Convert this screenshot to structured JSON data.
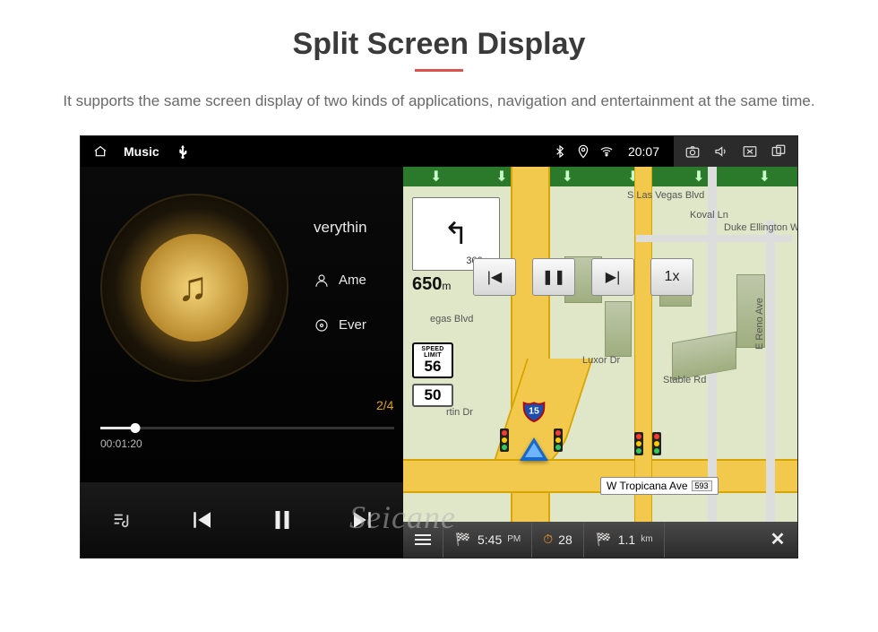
{
  "page": {
    "title": "Split Screen Display",
    "subtitle": "It supports the same screen display of two kinds of applications, navigation and entertainment at the same time."
  },
  "statusbar": {
    "app_label": "Music",
    "time": "20:07"
  },
  "music": {
    "track_title": "verythin",
    "artist": "Ame",
    "album": "Ever",
    "counter": "2/4",
    "elapsed": "00:01:20"
  },
  "nav": {
    "street_top": "S Las Vegas Blvd",
    "labels": {
      "koval": "Koval Ln",
      "duke": "Duke Ellington Way",
      "egas": "egas Blvd",
      "luxor": "Luxor Dr",
      "stable": "Stable Rd",
      "reno": "E Reno Ave",
      "rtindr": "rtin Dr"
    },
    "tropicana_label": "W Tropicana Ave",
    "tropicana_badge": "593",
    "turn": {
      "dist_small": "300 m",
      "dist_big": "650",
      "dist_big_unit": "m"
    },
    "speed": {
      "limit_label": "SPEED LIMIT",
      "limit": "56",
      "current": "50"
    },
    "interstate": "15",
    "map_play_speed": "1x",
    "bottom": {
      "eta": "5:45",
      "eta_ampm": "PM",
      "fuel": "28",
      "dist": "1.1",
      "dist_unit": "km"
    }
  },
  "watermark": "Seicane"
}
